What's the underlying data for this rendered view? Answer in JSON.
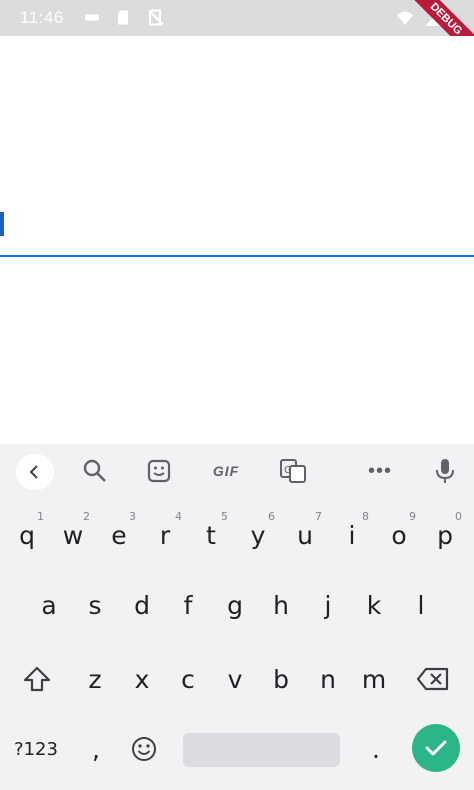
{
  "status_bar": {
    "time": "11:46",
    "debug_banner": "DEBUG"
  },
  "text_field": {
    "value": "",
    "accent_color": "#1976d2"
  },
  "keyboard": {
    "toolbar": {
      "back_icon": "chevron-left-icon",
      "search_icon": "search-icon",
      "sticker_icon": "sticker-icon",
      "gif_label": "GIF",
      "translate_icon": "translate-icon",
      "more_label": "•••",
      "mic_icon": "mic-icon"
    },
    "row1": [
      {
        "key": "q",
        "hint": "1"
      },
      {
        "key": "w",
        "hint": "2"
      },
      {
        "key": "e",
        "hint": "3"
      },
      {
        "key": "r",
        "hint": "4"
      },
      {
        "key": "t",
        "hint": "5"
      },
      {
        "key": "y",
        "hint": "6"
      },
      {
        "key": "u",
        "hint": "7"
      },
      {
        "key": "i",
        "hint": "8"
      },
      {
        "key": "o",
        "hint": "9"
      },
      {
        "key": "p",
        "hint": "0"
      }
    ],
    "row2": [
      "a",
      "s",
      "d",
      "f",
      "g",
      "h",
      "j",
      "k",
      "l"
    ],
    "row3": [
      "z",
      "x",
      "c",
      "v",
      "b",
      "n",
      "m"
    ],
    "symbols_label": "?123",
    "comma_label": ",",
    "period_label": ".",
    "done_color": "#2db58a"
  }
}
